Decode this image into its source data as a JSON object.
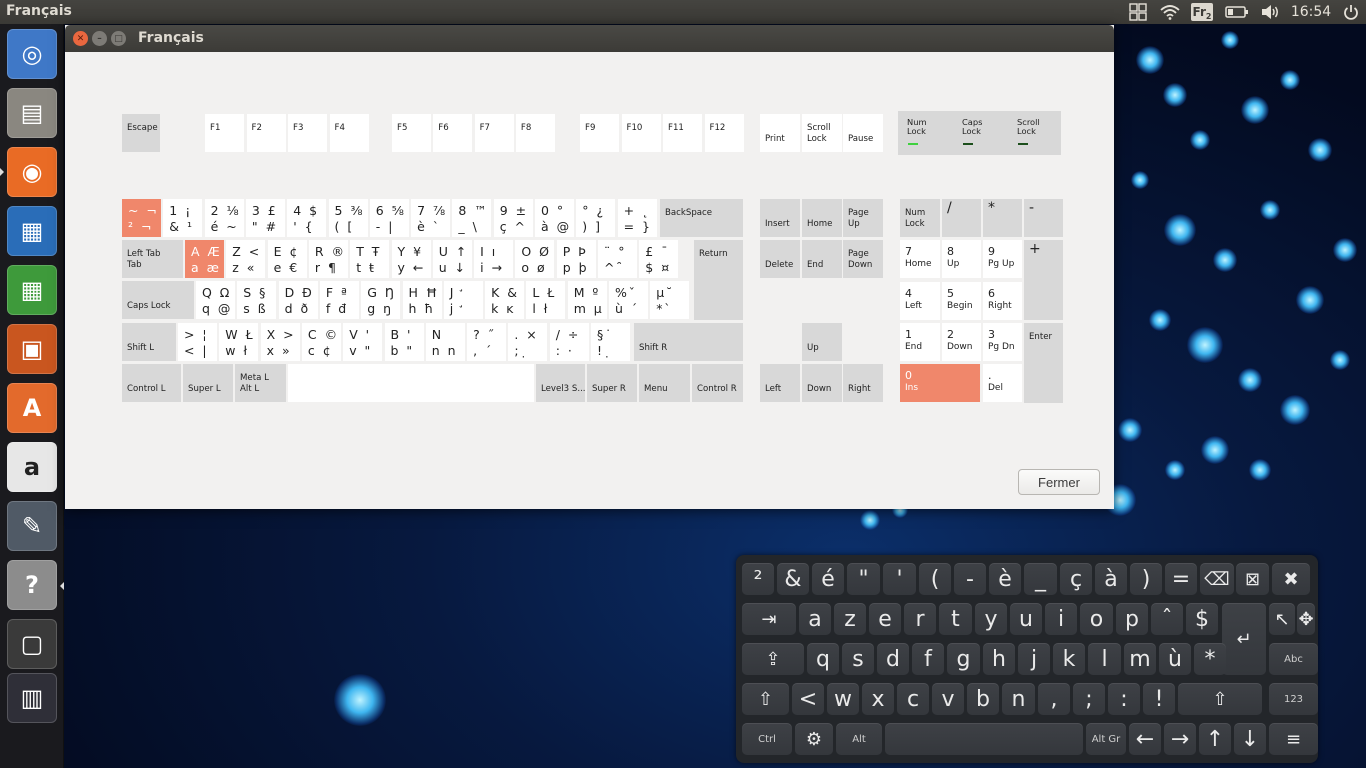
{
  "panel": {
    "app_title": "Français",
    "keyboard_layout": "Fr",
    "keyboard_layout_sub": "2",
    "clock": "16:54",
    "icons": [
      "workspace-switcher-icon",
      "wifi-icon",
      "keyboard-layout-icon",
      "battery-icon",
      "volume-icon",
      "power-icon"
    ]
  },
  "launcher": {
    "items": [
      {
        "name": "ubuntu-dash",
        "color": "#3f78c7"
      },
      {
        "name": "files",
        "color": "#8a8780"
      },
      {
        "name": "firefox",
        "color": "#e96b25"
      },
      {
        "name": "libreoffice-writer",
        "color": "#2a6db8"
      },
      {
        "name": "libreoffice-calc",
        "color": "#3e9a3b"
      },
      {
        "name": "libreoffice-impress",
        "color": "#c9561f"
      },
      {
        "name": "ubuntu-software",
        "color": "#e36a2c"
      },
      {
        "name": "amazon",
        "color": "#e7e7e7"
      },
      {
        "name": "system-settings",
        "color": "#505a66"
      },
      {
        "name": "help",
        "color": "#8c8c8c"
      },
      {
        "name": "onboard",
        "color": "#3a3a3a"
      },
      {
        "name": "workspaces",
        "color": "#2f2f38"
      }
    ]
  },
  "window": {
    "title": "Français",
    "close_button": "Fermer"
  },
  "keyboard_keys": [
    {
      "n": "key-escape",
      "t": "Escape",
      "g": 1
    },
    {
      "n": "key-f1",
      "t": "F1"
    },
    {
      "n": "key-f2",
      "t": "F2"
    },
    {
      "n": "key-f3",
      "t": "F3"
    },
    {
      "n": "key-f4",
      "t": "F4"
    },
    {
      "n": "key-f5",
      "t": "F5"
    },
    {
      "n": "key-f6",
      "t": "F6"
    },
    {
      "n": "key-f7",
      "t": "F7"
    },
    {
      "n": "key-f8",
      "t": "F8"
    },
    {
      "n": "key-f9",
      "t": "F9"
    },
    {
      "n": "key-f10",
      "t": "F10"
    },
    {
      "n": "key-f11",
      "t": "F11"
    },
    {
      "n": "key-f12",
      "t": "F12"
    },
    {
      "n": "key-print",
      "t": "Print",
      "b": 1
    },
    {
      "n": "key-scroll-lock",
      "t": "Scroll\nLock",
      "b": 1
    },
    {
      "n": "key-pause",
      "t": "Pause",
      "b": 1
    },
    {
      "n": "key-grave",
      "t": "~  ¬\n²  ¬",
      "o": 1,
      "cm": 1
    },
    {
      "n": "key-1",
      "t": "1  ¡\n&  ¹",
      "cm": 1
    },
    {
      "n": "key-2",
      "t": "2  ⅛\né  ~",
      "cm": 1
    },
    {
      "n": "key-3",
      "t": "3  £\n\"  #",
      "cm": 1
    },
    {
      "n": "key-4",
      "t": "4  $\n'  {",
      "cm": 1
    },
    {
      "n": "key-5",
      "t": "5  ⅜\n(  [",
      "cm": 1
    },
    {
      "n": "key-6",
      "t": "6  ⅝\n-  |",
      "cm": 1
    },
    {
      "n": "key-7",
      "t": "7  ⅞\nè  `",
      "cm": 1
    },
    {
      "n": "key-8",
      "t": "8  ™\n_  \\",
      "cm": 1
    },
    {
      "n": "key-9",
      "t": "9  ±\nç  ^",
      "cm": 1
    },
    {
      "n": "key-0",
      "t": "0  °\nà  @",
      "cm": 1
    },
    {
      "n": "key-minus",
      "t": "°  ¿\n)  ]",
      "cm": 1
    },
    {
      "n": "key-equal",
      "t": "+  ˛\n=  }",
      "cm": 1
    },
    {
      "n": "key-backspace",
      "t": "BackSpace",
      "g": 1
    },
    {
      "n": "key-tab",
      "t": "Left Tab\nTab",
      "g": 1
    },
    {
      "n": "key-a",
      "t": "A  Æ\na  æ",
      "o": 1,
      "cm": 1
    },
    {
      "n": "key-z",
      "t": "Z  <\nz  «",
      "cm": 1
    },
    {
      "n": "key-e",
      "t": "E  ¢\ne  €",
      "cm": 1
    },
    {
      "n": "key-r",
      "t": "R  ®\nr  ¶",
      "cm": 1
    },
    {
      "n": "key-t",
      "t": "T  Ŧ\nt  ŧ",
      "cm": 1
    },
    {
      "n": "key-y",
      "t": "Y  ¥\ny  ←",
      "cm": 1
    },
    {
      "n": "key-u",
      "t": "U  ↑\nu  ↓",
      "cm": 1
    },
    {
      "n": "key-i",
      "t": "I  ı\ni  →",
      "cm": 1
    },
    {
      "n": "key-o",
      "t": "O  Ø\no  ø",
      "cm": 1
    },
    {
      "n": "key-p",
      "t": "P  Þ\np  þ",
      "cm": 1
    },
    {
      "n": "key-bracketleft",
      "t": "¨  °\n^  ̑",
      "cm": 1
    },
    {
      "n": "key-bracketright",
      "t": "£  ¯\n$  ¤",
      "cm": 1
    },
    {
      "n": "key-return",
      "t": "Return",
      "g": 1
    },
    {
      "n": "key-caps-lock",
      "t": "Caps Lock",
      "g": 1,
      "b": 1
    },
    {
      "n": "key-q",
      "t": "Q  Ω\nq  @",
      "cm": 1
    },
    {
      "n": "key-s",
      "t": "S  §\ns  ß",
      "cm": 1
    },
    {
      "n": "key-d",
      "t": "D  Ð\nd  ð",
      "cm": 1
    },
    {
      "n": "key-f",
      "t": "F  ª\nf  đ",
      "cm": 1
    },
    {
      "n": "key-g",
      "t": "G  Ŋ\ng  ŋ",
      "cm": 1
    },
    {
      "n": "key-h",
      "t": "H  Ħ\nh  ħ",
      "cm": 1
    },
    {
      "n": "key-j",
      "t": "J  ̛\nj  ̛",
      "cm": 1
    },
    {
      "n": "key-k",
      "t": "K  &\nk  ĸ",
      "cm": 1
    },
    {
      "n": "key-l",
      "t": "L  Ł\nl  ł",
      "cm": 1
    },
    {
      "n": "key-m",
      "t": "M  º\nm  µ",
      "cm": 1
    },
    {
      "n": "key-apostrophe",
      "t": "%  ̌\nù  ´",
      "cm": 1
    },
    {
      "n": "key-asterisk",
      "t": "µ  ̆\n*  ̀",
      "cm": 1
    },
    {
      "n": "key-shift-l",
      "t": "Shift L",
      "g": 1,
      "b": 1
    },
    {
      "n": "key-less",
      "t": ">  ¦\n<  |",
      "cm": 1
    },
    {
      "n": "key-w",
      "t": "W  Ł\nw  ł",
      "cm": 1
    },
    {
      "n": "key-x",
      "t": "X  >\nx  »",
      "cm": 1
    },
    {
      "n": "key-c",
      "t": "C  ©\nc  ¢",
      "cm": 1
    },
    {
      "n": "key-v",
      "t": "V  '\nv  \"",
      "cm": 1
    },
    {
      "n": "key-b",
      "t": "B  '\nb  \"",
      "cm": 1
    },
    {
      "n": "key-n",
      "t": "N  \nn  n",
      "cm": 1
    },
    {
      "n": "key-comma",
      "t": "?  ˝\n,  ´",
      "cm": 1
    },
    {
      "n": "key-semicolon",
      "t": ".  ×\n;  ̣",
      "cm": 1
    },
    {
      "n": "key-colon",
      "t": "/  ÷\n:  ·",
      "cm": 1
    },
    {
      "n": "key-exclam",
      "t": "§  ̇\n!  ̣",
      "cm": 1
    },
    {
      "n": "key-shift-r",
      "t": "Shift R",
      "g": 1,
      "b": 1
    },
    {
      "n": "key-control-l",
      "t": "Control L",
      "g": 1,
      "b": 1
    },
    {
      "n": "key-super-l",
      "t": "Super L",
      "g": 1,
      "b": 1
    },
    {
      "n": "key-alt-l",
      "t": "Meta L\nAlt L",
      "g": 1
    },
    {
      "n": "key-space",
      "t": ""
    },
    {
      "n": "key-level3",
      "t": "Level3 S...",
      "g": 1,
      "b": 1
    },
    {
      "n": "key-super-r",
      "t": "Super R",
      "g": 1,
      "b": 1
    },
    {
      "n": "key-menu",
      "t": "Menu",
      "g": 1,
      "b": 1
    },
    {
      "n": "key-control-r",
      "t": "Control R",
      "g": 1,
      "b": 1
    },
    {
      "n": "key-insert",
      "t": "Insert",
      "g": 1,
      "b": 1
    },
    {
      "n": "key-home",
      "t": "Home",
      "g": 1,
      "b": 1
    },
    {
      "n": "key-page-up",
      "t": "Page\nUp",
      "g": 1,
      "b": 1
    },
    {
      "n": "key-delete",
      "t": "Delete",
      "g": 1,
      "b": 1
    },
    {
      "n": "key-end",
      "t": "End",
      "g": 1,
      "b": 1
    },
    {
      "n": "key-page-down",
      "t": "Page\nDown",
      "g": 1,
      "b": 1
    },
    {
      "n": "key-up",
      "t": "Up",
      "g": 1,
      "b": 1
    },
    {
      "n": "key-left",
      "t": "Left",
      "g": 1,
      "b": 1
    },
    {
      "n": "key-down",
      "t": "Down",
      "g": 1,
      "b": 1
    },
    {
      "n": "key-right",
      "t": "Right",
      "g": 1,
      "b": 1
    },
    {
      "n": "key-num-lock",
      "t": "Num\nLock",
      "g": 1,
      "b": 1
    },
    {
      "n": "key-kp-divide",
      "t": "/",
      "g": 1,
      "big": 1
    },
    {
      "n": "key-kp-multiply",
      "t": "*",
      "g": 1,
      "big": 1
    },
    {
      "n": "key-kp-subtract",
      "t": "-",
      "g": 1,
      "big": 1
    },
    {
      "n": "key-kp-7",
      "t": "7\nHome",
      "nb": 1
    },
    {
      "n": "key-kp-8",
      "t": "8\nUp",
      "nb": 1
    },
    {
      "n": "key-kp-9",
      "t": "9\nPg Up",
      "nb": 1
    },
    {
      "n": "key-kp-add",
      "t": "+",
      "g": 1,
      "big": 1
    },
    {
      "n": "key-kp-4",
      "t": "4\nLeft",
      "nb": 1
    },
    {
      "n": "key-kp-5",
      "t": "5\nBegin",
      "nb": 1
    },
    {
      "n": "key-kp-6",
      "t": "6\nRight",
      "nb": 1
    },
    {
      "n": "key-kp-1",
      "t": "1\nEnd",
      "nb": 1
    },
    {
      "n": "key-kp-2",
      "t": "2\nDown",
      "nb": 1
    },
    {
      "n": "key-kp-3",
      "t": "3\nPg Dn",
      "nb": 1
    },
    {
      "n": "key-kp-enter",
      "t": "Enter",
      "g": 1
    },
    {
      "n": "key-kp-0",
      "t": "0\nIns",
      "o": 1,
      "nb": 1
    },
    {
      "n": "key-kp-decimal",
      "t": ".\nDel",
      "nb": 1
    }
  ],
  "leds": [
    {
      "label": "Num\nLock",
      "on": true
    },
    {
      "label": "Caps\nLock",
      "on": false
    },
    {
      "label": "Scroll\nLock",
      "on": false
    }
  ],
  "onboard_rows": [
    [
      "²",
      "&",
      "é",
      "\"",
      "'",
      "(",
      "-",
      "è",
      "_",
      "ç",
      "à",
      ")",
      "=",
      "⌫",
      "⊠",
      "✖"
    ],
    [
      "⇥",
      "a",
      "z",
      "e",
      "r",
      "t",
      "y",
      "u",
      "i",
      "o",
      "p",
      "ˆ",
      "$",
      "↵",
      "↖",
      "✥"
    ],
    [
      "⇪",
      "q",
      "s",
      "d",
      "f",
      "g",
      "h",
      "j",
      "k",
      "l",
      "m",
      "ù",
      "*",
      "Abc"
    ],
    [
      "⇧",
      "<",
      "w",
      "x",
      "c",
      "v",
      "b",
      "n",
      ",",
      ";",
      ":",
      "!",
      "⇧",
      "123"
    ],
    [
      "Ctrl",
      "⚙",
      "Alt",
      "",
      "Alt Gr",
      "←",
      "→",
      "↑",
      "↓",
      "≡"
    ]
  ],
  "colors": {
    "accent": "#f0876b",
    "panel": "#3c3b37",
    "led_on": "#3fd13f",
    "led_off": "#1c4f1c"
  }
}
